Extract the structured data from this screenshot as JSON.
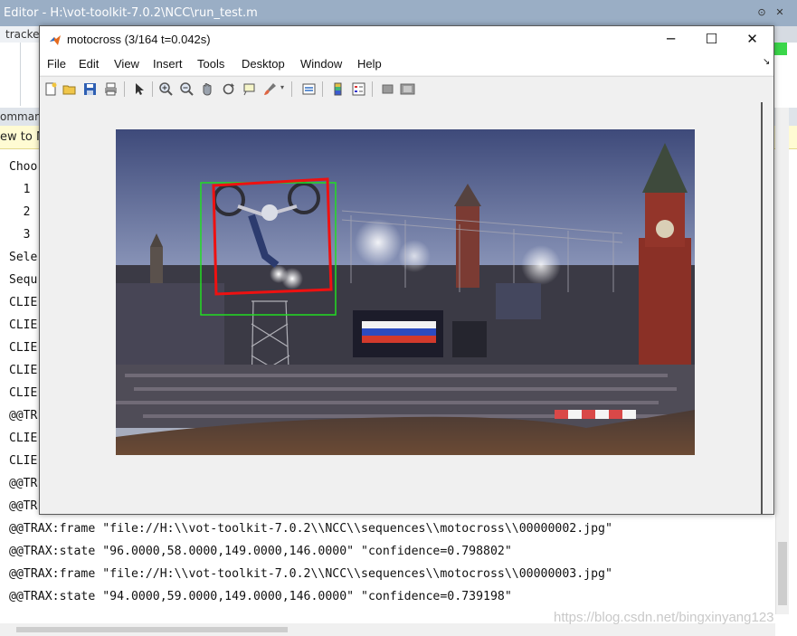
{
  "editor": {
    "title": "Editor - H:\\vot-toolkit-7.0.2\\NCC\\run_test.m",
    "tab": "tracke",
    "command_header": "ommand",
    "notice": "ew to M"
  },
  "command_window": {
    "truncated_lines": [
      "Choo",
      "  1",
      "  2",
      "  3",
      "Sele",
      "Sequ",
      "CLIE",
      "CLIE",
      "CLIE",
      "CLIE",
      "CLIE",
      "@@TR",
      "CLIE",
      "CLIE",
      "@@TR",
      "@@TR"
    ],
    "full_lines": [
      "@@TRAX:frame \"file://H:\\\\vot-toolkit-7.0.2\\\\NCC\\\\sequences\\\\motocross\\\\00000002.jpg\"",
      "@@TRAX:state \"96.0000,58.0000,149.0000,146.0000\" \"confidence=0.798802\"",
      "@@TRAX:frame \"file://H:\\\\vot-toolkit-7.0.2\\\\NCC\\\\sequences\\\\motocross\\\\00000003.jpg\"",
      "@@TRAX:state \"94.0000,59.0000,149.0000,146.0000\" \"confidence=0.739198\""
    ]
  },
  "watermark": "https://blog.csdn.net/bingxinyang123",
  "figure": {
    "title": "motocross (3/164 t=0.042s)",
    "window_buttons": {
      "minimize": "─",
      "maximize": "☐",
      "close": "✕"
    },
    "menus": [
      "File",
      "Edit",
      "View",
      "Insert",
      "Tools",
      "Desktop",
      "Window",
      "Help"
    ],
    "toolbar_icons": [
      "new-figure-icon",
      "open-file-icon",
      "save-icon",
      "print-icon",
      "pointer-icon",
      "zoom-in-icon",
      "zoom-out-icon",
      "pan-icon",
      "rotate-icon",
      "data-cursor-icon",
      "brush-icon",
      "link-icon",
      "colorbar-icon",
      "legend-icon",
      "hide-plot-tools-icon",
      "show-plot-tools-icon"
    ],
    "boxes": {
      "green_color": "#22dd22",
      "red_color": "#ee1111"
    }
  },
  "colors": {
    "editor_title_bg": "#9aaec5",
    "notice_bg": "#fffbd3"
  }
}
